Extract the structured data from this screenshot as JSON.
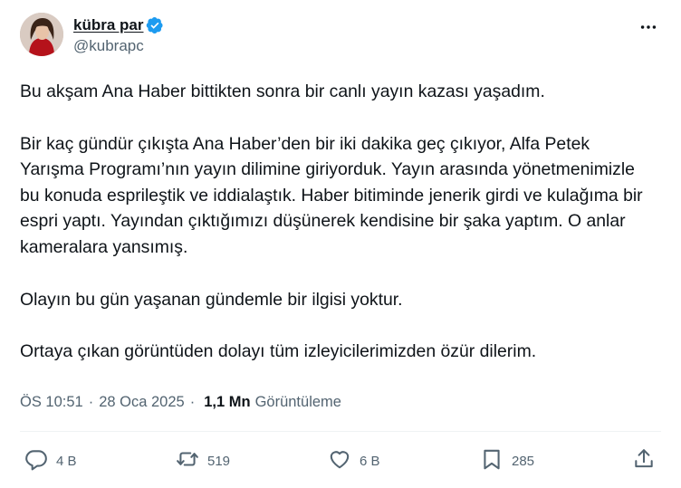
{
  "author": {
    "display_name": "kübra par",
    "handle": "@kubrapc",
    "verified": true
  },
  "tweet": {
    "paragraphs": [
      "Bu akşam Ana Haber bittikten sonra bir canlı yayın kazası yaşadım.",
      "Bir kaç gündür çıkışta Ana Haber’den bir iki dakika geç çıkıyor, Alfa Petek Yarışma Programı’nın yayın dilimine giriyorduk. Yayın arasında yönetmenimizle bu konuda esprileştik ve iddialaştık. Haber bitiminde jenerik girdi ve kulağıma bir espri yaptı. Yayından çıktığımızı düşünerek kendisine bir şaka yaptım. O anlar kameralara yansımış.",
      "Olayın bu gün yaşanan gündemle bir ilgisi yoktur.",
      "Ortaya çıkan görüntüden dolayı tüm izleyicilerimizden özür dilerim."
    ]
  },
  "meta": {
    "time": "ÖS 10:51",
    "separator": "·",
    "date": "28 Oca 2025",
    "views_count": "1,1 Mn",
    "views_label": "Görüntüleme"
  },
  "actions": {
    "reply_count": "4 B",
    "repost_count": "519",
    "like_count": "6 B",
    "bookmark_count": "285"
  },
  "colors": {
    "text": "#0f1419",
    "secondary": "#536471",
    "verified_blue": "#1d9bf0"
  },
  "icons": [
    "more-icon",
    "verified-badge-icon",
    "reply-icon",
    "repost-icon",
    "like-icon",
    "bookmark-icon",
    "share-icon"
  ]
}
